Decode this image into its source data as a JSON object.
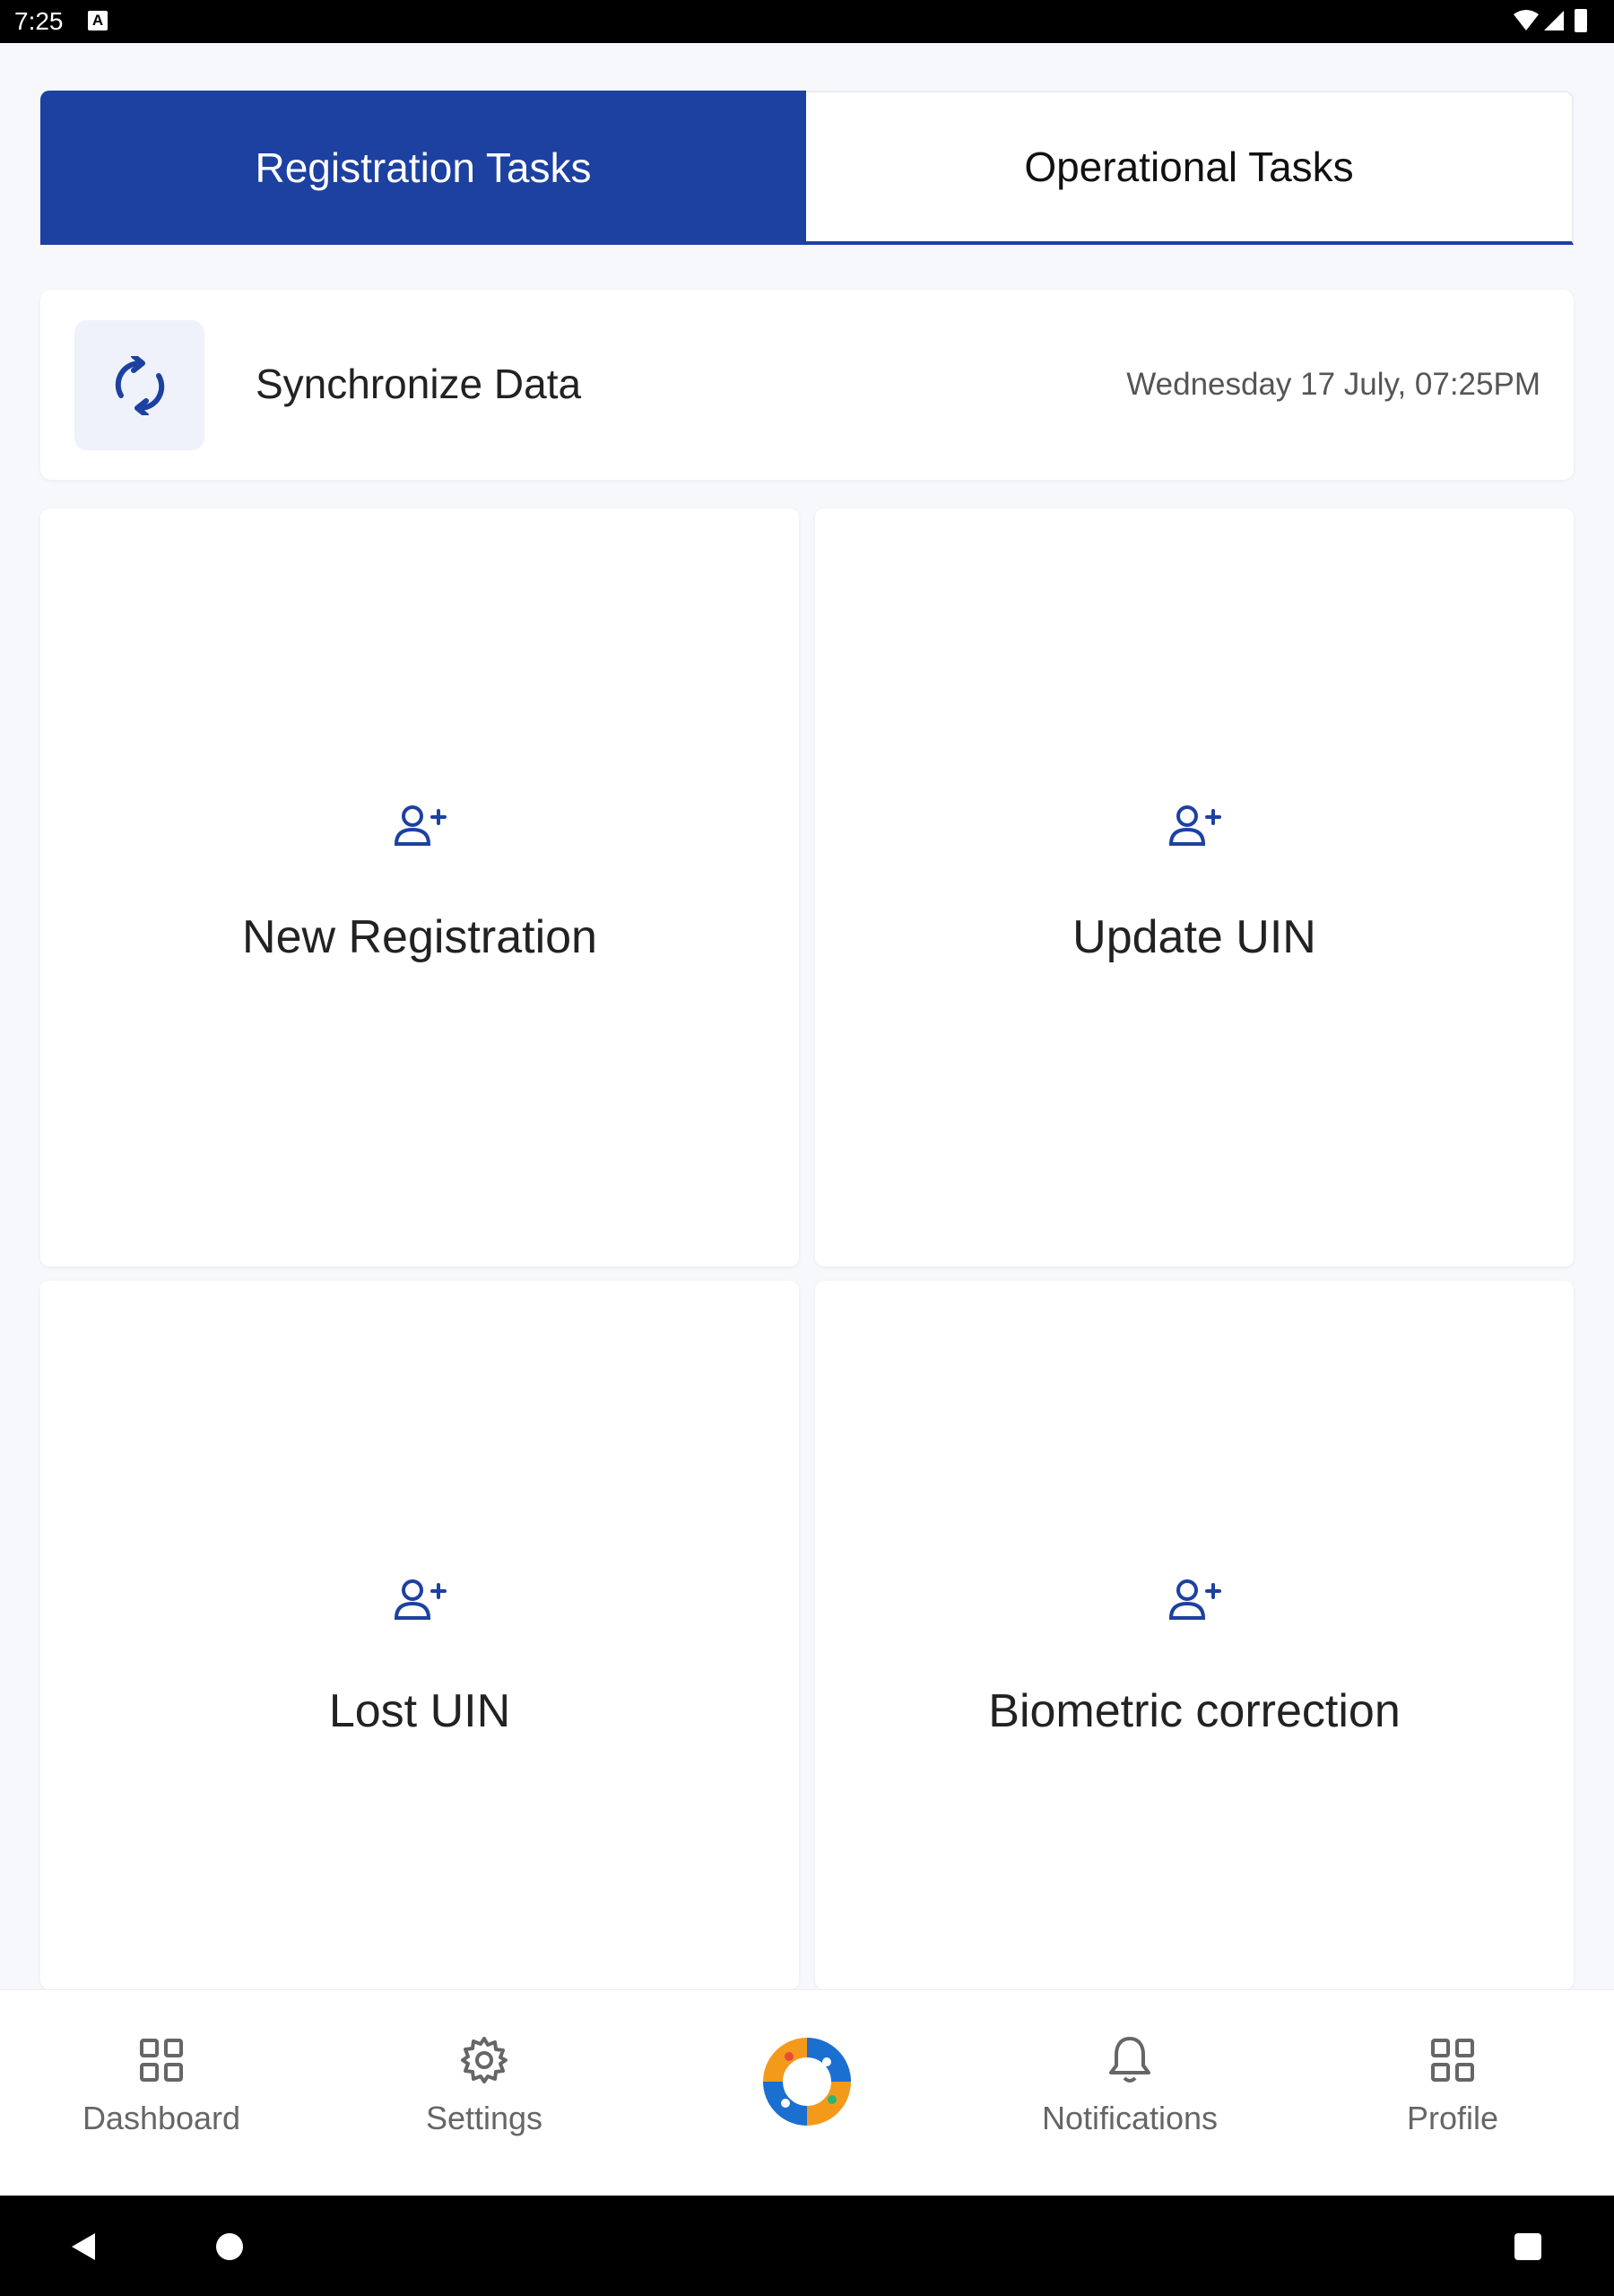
{
  "status_bar": {
    "time": "7:25",
    "indicator": "A"
  },
  "tabs": {
    "active": "Registration Tasks",
    "inactive": "Operational Tasks"
  },
  "sync": {
    "title": "Synchronize Data",
    "timestamp": "Wednesday 17 July, 07:25PM"
  },
  "tasks": [
    {
      "label": "New Registration"
    },
    {
      "label": "Update UIN"
    },
    {
      "label": "Lost UIN"
    },
    {
      "label": "Biometric correction"
    }
  ],
  "bottom_nav": {
    "dashboard": "Dashboard",
    "settings": "Settings",
    "notifications": "Notifications",
    "profile": "Profile"
  },
  "colors": {
    "primary": "#1d41a1",
    "background": "#f7f8fb",
    "card": "#ffffff"
  }
}
